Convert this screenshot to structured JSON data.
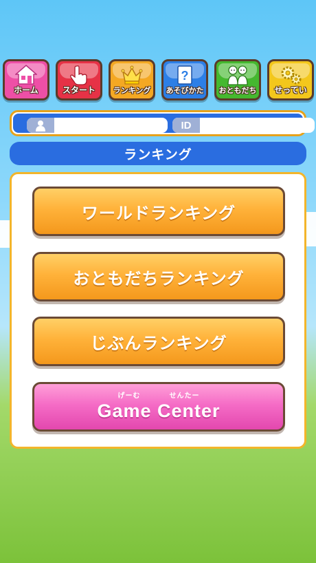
{
  "nav": {
    "items": [
      {
        "label": "ホーム",
        "icon": "home-icon",
        "color": "#ee4fa6"
      },
      {
        "label": "スタート",
        "icon": "hand-pointer-icon",
        "color": "#e63246"
      },
      {
        "label": "ランキング",
        "icon": "crown-icon",
        "color": "#f4a823"
      },
      {
        "label": "あそびかた",
        "icon": "question-icon",
        "color": "#2d7fe6"
      },
      {
        "label": "おともだち",
        "icon": "friends-icon",
        "color": "#45b82f"
      },
      {
        "label": "せってい",
        "icon": "gears-icon",
        "color": "#f3c71c"
      }
    ]
  },
  "profile": {
    "user_value": "",
    "id_label": "ID",
    "id_value": ""
  },
  "section": {
    "title": "ランキング"
  },
  "menu": {
    "world_ranking": "ワールドランキング",
    "friends_ranking": "おともだちランキング",
    "my_ranking": "じぶんランキング",
    "game_center": "Game Center",
    "game_center_ruby_game": "げーむ",
    "game_center_ruby_center": "せんたー"
  }
}
